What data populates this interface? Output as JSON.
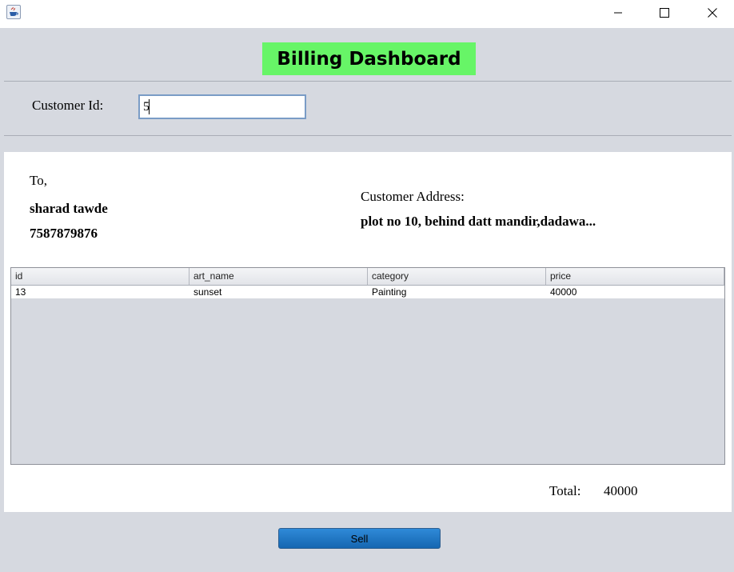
{
  "window": {
    "controls": [
      "minimize-icon",
      "maximize-icon",
      "close-icon"
    ]
  },
  "header": {
    "title": "Billing Dashboard",
    "title_bg": "#67f567"
  },
  "customer_search": {
    "label": "Customer Id:",
    "value": "5"
  },
  "bill": {
    "to_label": "To,",
    "customer_name": "sharad tawde",
    "customer_phone": "7587879876",
    "address_label": "Customer Address:",
    "address_value": "plot no 10, behind datt mandir,dadawa..."
  },
  "table": {
    "columns": [
      "id",
      "art_name",
      "category",
      "price"
    ],
    "rows": [
      [
        "13",
        "sunset",
        "Painting",
        "40000"
      ]
    ]
  },
  "total": {
    "label": "Total:",
    "value": "40000"
  },
  "actions": {
    "sell_label": "Sell",
    "sell_color": "#1f78c8"
  }
}
